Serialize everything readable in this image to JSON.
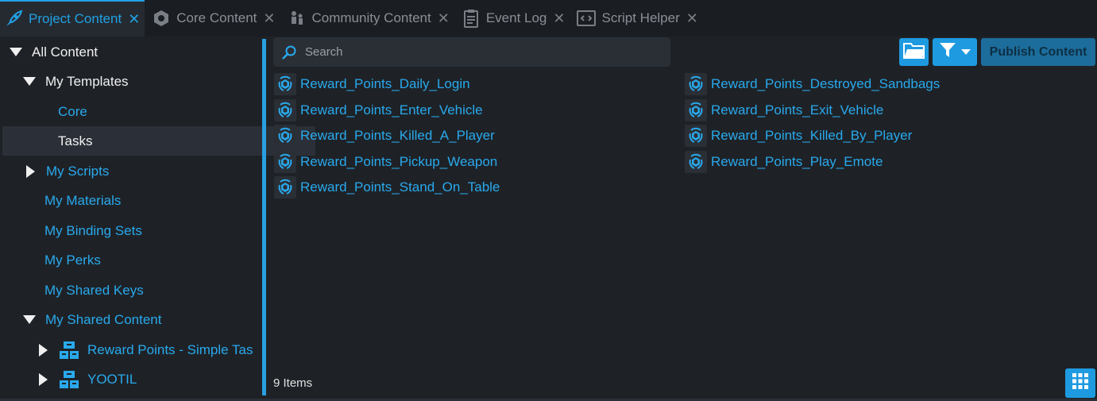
{
  "tabs": [
    {
      "label": "Project Content",
      "icon": "rocket-icon",
      "active": true
    },
    {
      "label": "Core Content",
      "icon": "core-hex-icon",
      "active": false
    },
    {
      "label": "Community Content",
      "icon": "people-icon",
      "active": false
    },
    {
      "label": "Event Log",
      "icon": "clipboard-icon",
      "active": false
    },
    {
      "label": "Script Helper",
      "icon": "code-window-icon",
      "active": false
    }
  ],
  "tree": {
    "all_content": "All Content",
    "my_templates": "My Templates",
    "core": "Core",
    "tasks": "Tasks",
    "my_scripts": "My Scripts",
    "my_materials": "My Materials",
    "my_binding_sets": "My Binding Sets",
    "my_perks": "My Perks",
    "my_shared_keys": "My Shared Keys",
    "my_shared_content": "My Shared Content",
    "shared_items": [
      "Reward Points - Simple Tas",
      "YOOTIL"
    ]
  },
  "search": {
    "placeholder": "Search",
    "value": ""
  },
  "toolbar": {
    "publish_label": "Publish Content"
  },
  "items": [
    "Reward_Points_Daily_Login",
    "Reward_Points_Destroyed_Sandbags",
    "Reward_Points_Enter_Vehicle",
    "Reward_Points_Exit_Vehicle",
    "Reward_Points_Killed_A_Player",
    "Reward_Points_Killed_By_Player",
    "Reward_Points_Pickup_Weapon",
    "Reward_Points_Play_Emote",
    "Reward_Points_Stand_On_Table"
  ],
  "status": {
    "count": "9 Items"
  },
  "colors": {
    "accent": "#29a9ec",
    "button": "#1e9ae0",
    "background": "#1e2227"
  }
}
